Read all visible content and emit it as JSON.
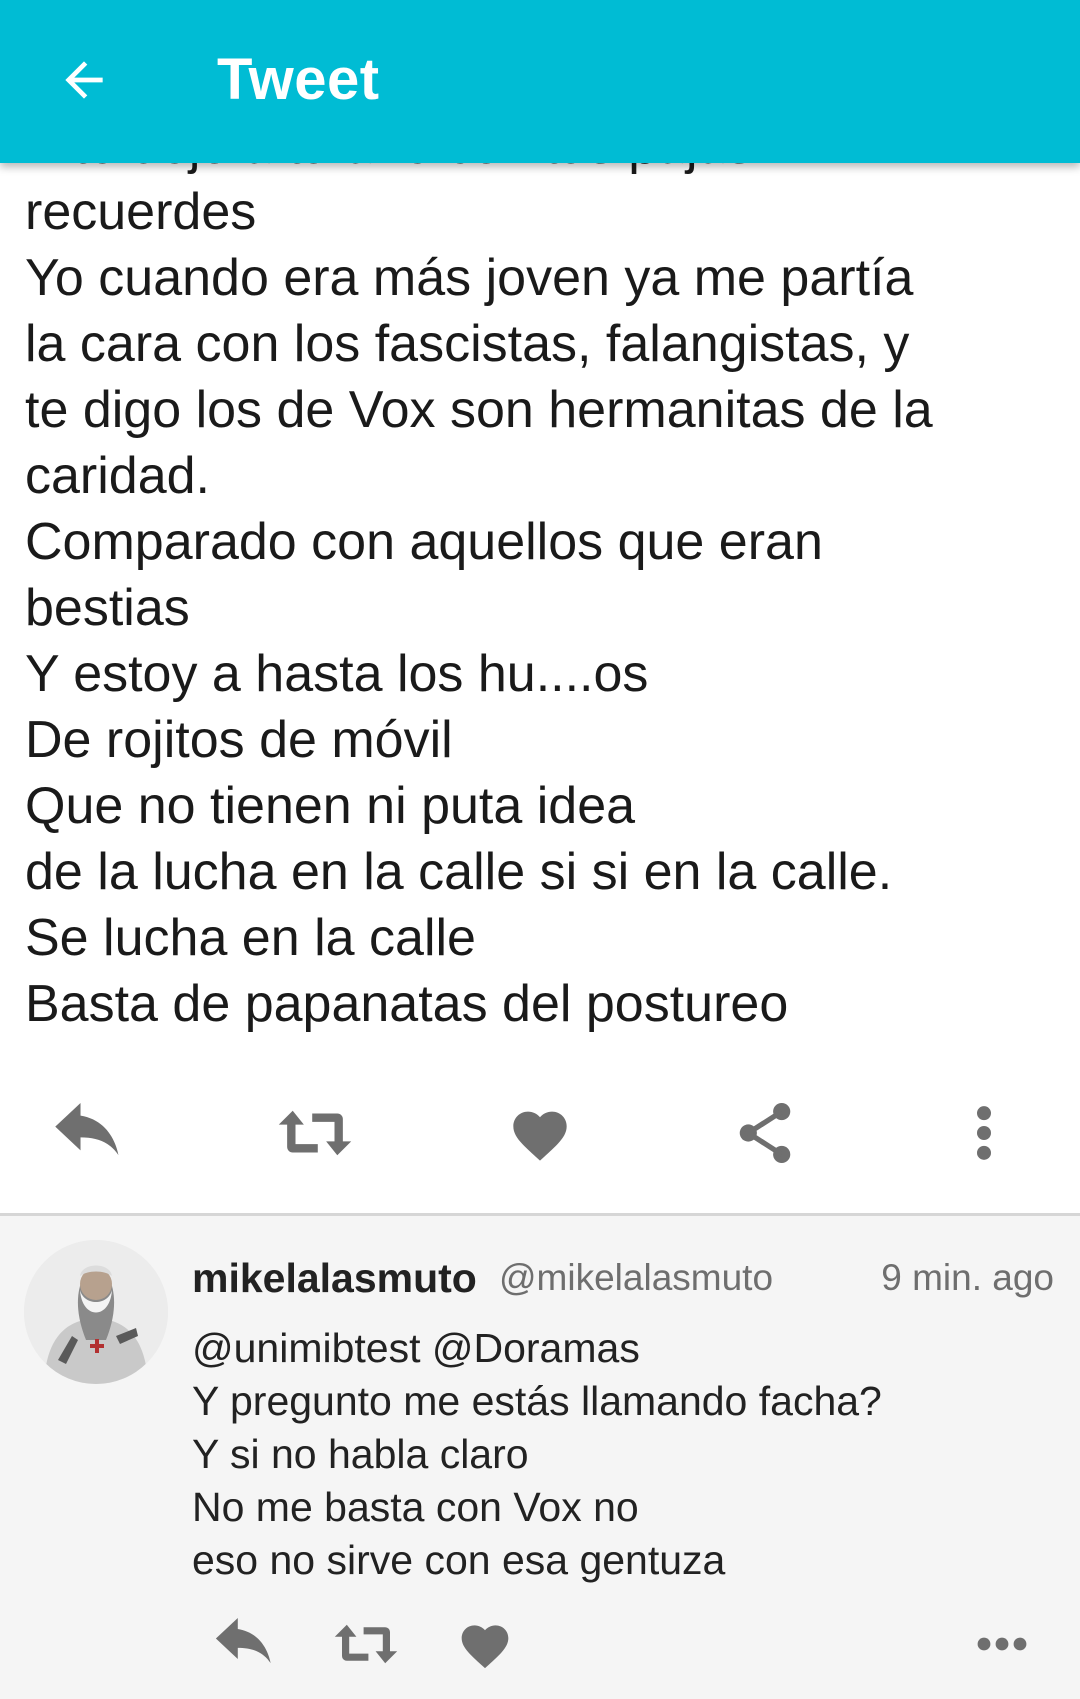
{
  "app_bar": {
    "title": "Tweet",
    "color": "#00bcd4",
    "back_icon": "arrow-back-icon"
  },
  "tweet": {
    "lines": [
      "Y te dejo a tu aire con tus pajas",
      "recuerdes",
      "Yo cuando era más joven ya me partía",
      "la cara con los fascistas, falangistas, y",
      "te digo los de Vox son hermanitas de la",
      "caridad.",
      "Comparado con aquellos que eran",
      "bestias",
      "Y estoy a hasta los hu....os",
      "De rojitos de móvil",
      "Que no tienen ni puta idea",
      "de la lucha en la calle si si en la calle.",
      "Se lucha en la calle",
      "Basta de papanatas del postureo"
    ],
    "actions": [
      "reply-icon",
      "retweet-icon",
      "heart-icon",
      "share-icon",
      "more-vertical-icon"
    ]
  },
  "reply": {
    "name": "mikelalasmuto",
    "handle": "@mikelalasmuto",
    "time": "9 min. ago",
    "lines": [
      "@unimibtest @Doramas",
      "Y pregunto me estás llamando facha?",
      "Y si no habla claro",
      "No me basta con Vox no",
      "eso no sirve con esa gentuza"
    ],
    "actions": [
      "reply-icon",
      "retweet-icon",
      "heart-icon",
      "more-horizontal-icon"
    ]
  }
}
